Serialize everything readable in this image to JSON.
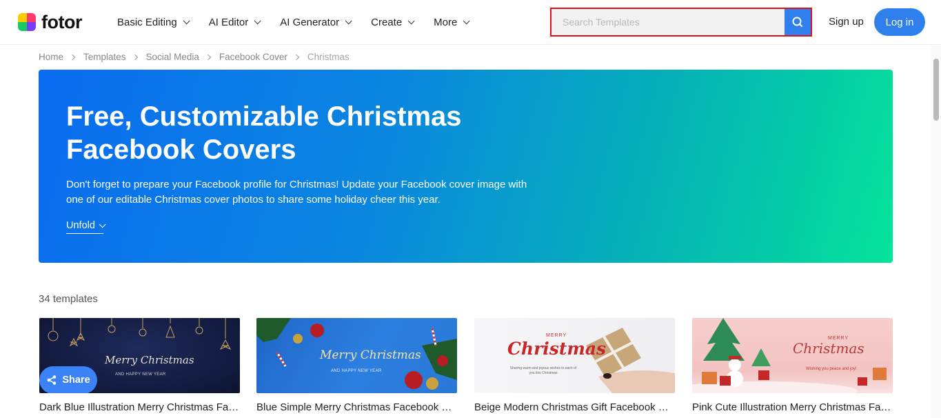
{
  "header": {
    "logo_text": "fotor",
    "nav": [
      {
        "label": "Basic Editing"
      },
      {
        "label": "AI Editor"
      },
      {
        "label": "AI Generator"
      },
      {
        "label": "Create"
      },
      {
        "label": "More"
      }
    ],
    "search": {
      "placeholder": "Search Templates",
      "value": ""
    },
    "signup_label": "Sign up",
    "login_label": "Log in"
  },
  "breadcrumb": [
    {
      "label": "Home"
    },
    {
      "label": "Templates"
    },
    {
      "label": "Social Media"
    },
    {
      "label": "Facebook Cover"
    },
    {
      "label": "Christmas"
    }
  ],
  "hero": {
    "title": "Free, Customizable Christmas Facebook Covers",
    "description": "Don't forget to prepare your Facebook profile for Christmas! Update your Facebook cover image with one of our editable Christmas cover photos to share some holiday cheer this year.",
    "unfold_label": "Unfold"
  },
  "templates": {
    "count_label": "34 templates",
    "share_label": "Share",
    "items": [
      {
        "title": "Dark Blue Illustration Merry Christmas Facebook Cover",
        "art_text": "Merry Christmas",
        "art_sub": "AND HAPPY NEW YEAR"
      },
      {
        "title": "Blue Simple Merry Christmas Facebook Cover",
        "art_text": "Merry Christmas",
        "art_sub": "AND HAPPY NEW YEAR"
      },
      {
        "title": "Beige Modern Christmas Gift Facebook Cover",
        "art_text": "Christmas",
        "art_top": "MERRY",
        "art_sub": "Sharing warm and joyous wishes to each of you this Christmas"
      },
      {
        "title": "Pink Cute Illustration Merry Christmas Facebook Cover",
        "art_text": "Christmas",
        "art_top": "MERRY",
        "art_sub": "Wishing you peace and joy!"
      }
    ]
  },
  "colors": {
    "accent": "#2f80ed",
    "search_border": "#e0101a",
    "hero_gradient_start": "#0a6cf0",
    "hero_gradient_end": "#05e39a"
  }
}
